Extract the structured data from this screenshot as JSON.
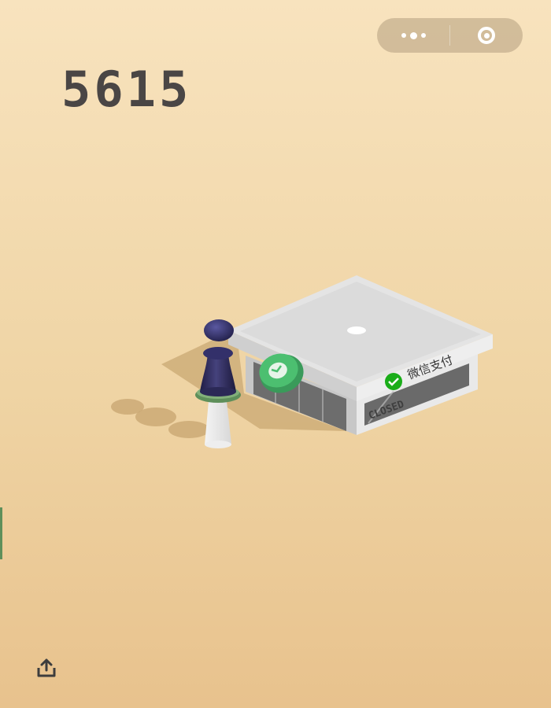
{
  "score": "5615",
  "capsule": {
    "menu_icon": "more-dots-icon",
    "close_icon": "target-ring-icon"
  },
  "building": {
    "sign_text": "微信支付",
    "door_text": "CLOSED"
  },
  "share_icon": "share-upload-icon",
  "colors": {
    "background_top": "#f8e3be",
    "background_bottom": "#e8c28d",
    "score_text": "#4a4645",
    "piece": "#2e2c5c",
    "wechat_green": "#1aad19",
    "coin_green": "#4cbf70"
  }
}
